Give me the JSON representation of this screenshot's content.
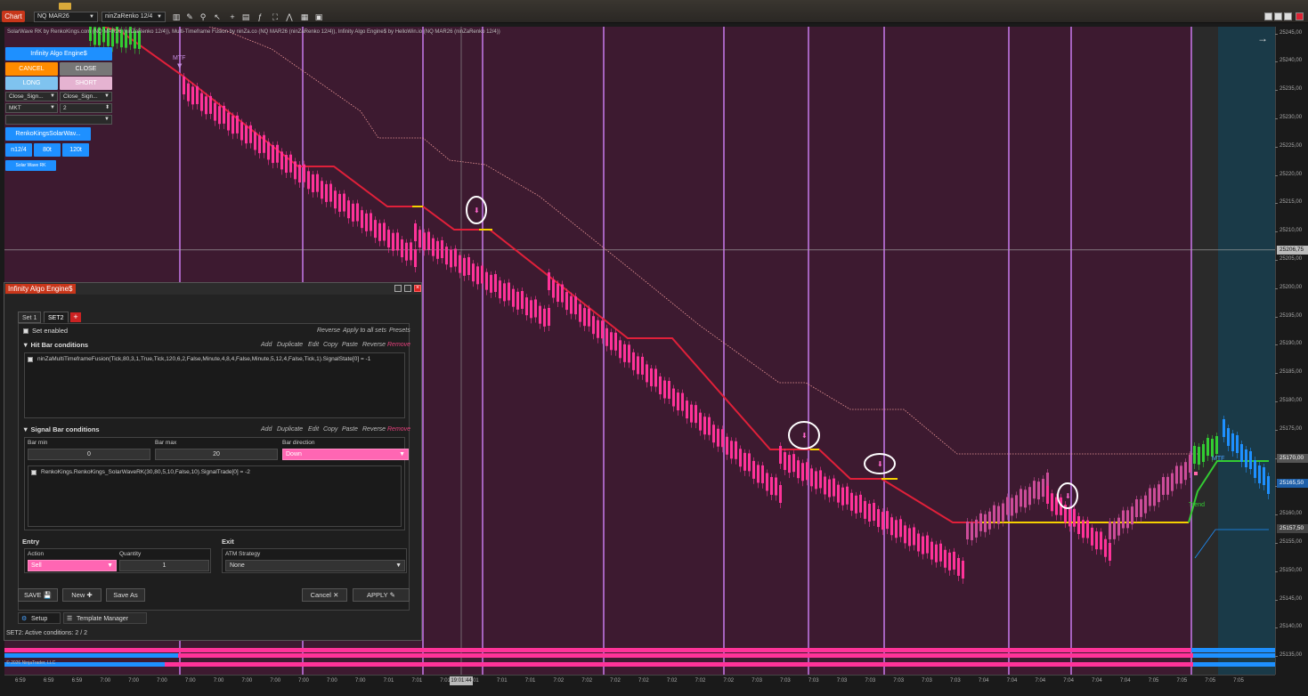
{
  "window": {
    "chart_tab": "Chart"
  },
  "toolbar": {
    "instrument": "NQ MAR26",
    "bar_type": "ninZaRenko 12/4"
  },
  "chart": {
    "legend": "SolarWave RK by RenkoKings.com (NQ MAR26 (ninZaRenko 12/4)), Multi-Timeframe Fusion by ninZa.co (NQ MAR26 (ninZaRenko 12/4)), Infinity Algo Engine$ by HelloWin.io (NQ MAR26 (ninZaRenko 12/4))",
    "mtf_label": "MTF",
    "trend_label": "Trend",
    "mtf_label_2": "MTF",
    "price_labels": [
      "25245,00",
      "25240,00",
      "25235,00",
      "25230,00",
      "25225,00",
      "25220,00",
      "25215,00",
      "25210,00",
      "25205,00",
      "25200,00",
      "25195,00",
      "25190,00",
      "25185,00",
      "25180,00",
      "25175,00",
      "25170,00",
      "25165,00",
      "25160,00",
      "25155,00",
      "25150,00",
      "25145,00",
      "25140,00",
      "25135,00"
    ],
    "price_badges": {
      "crosshair": "25206,75",
      "current": "25170,00",
      "blue": "25165,50",
      "low": "25157,50"
    },
    "time_labels": [
      "6:59",
      "6:59",
      "6:59",
      "7:00",
      "7:00",
      "7:00",
      "7:00",
      "7:00",
      "7:00",
      "7:00",
      "7:00",
      "7:00",
      "7:00",
      "7:01",
      "7:01",
      "7:01",
      "7:01",
      "7:01",
      "7:01",
      "7:02",
      "7:02",
      "7:02",
      "7:02",
      "7:02",
      "7:02",
      "7:02",
      "7:03",
      "7:03",
      "7:03",
      "7:03",
      "7:03",
      "7:03",
      "7:03",
      "7:03",
      "7:04",
      "7:04",
      "7:04",
      "7:04",
      "7:04",
      "7:04",
      "7:05",
      "7:05",
      "7:05",
      "7:05"
    ],
    "time_cursor": "19:01:44",
    "copyright": "© 2026 NinjaTrader, LLC"
  },
  "trade_panel": {
    "title": "Infinity Algo Engine$",
    "cancel": "CANCEL",
    "close": "CLOSE",
    "long": "LONG",
    "short": "SHORT",
    "select1": "Close_Sign...",
    "select2": "Close_Sign...",
    "order_type": "MKT",
    "qty": "2",
    "template": "RenkoKingsSolarWav...",
    "btn_a": "n12/4",
    "btn_b": "80t",
    "btn_c": "120t",
    "tag": "Solar Wave RK"
  },
  "algo": {
    "title": "Infinity Algo Engine$",
    "tabs": [
      "Set 1",
      "SET2"
    ],
    "tab_add": "+",
    "set_enabled": "Set enabled",
    "reverse": "Reverse",
    "apply_all": "Apply to all sets",
    "presets": "Presets",
    "hit_bar": "Hit Bar conditions",
    "signal_bar": "Signal Bar conditions",
    "actions": {
      "add": "Add",
      "duplicate": "Duplicate",
      "edit": "Edit",
      "copy": "Copy",
      "paste": "Paste",
      "reverse": "Reverse",
      "remove": "Remove"
    },
    "hit_condition": "ninZaMultiTimeframeFusion(Tick,80,3,1,True,Tick,120,6,2,False,Minute,4,8,4,False,Minute,5,12,4,False,Tick,1).SignalState[0] = -1",
    "bar_min_label": "Bar min",
    "bar_min": "0",
    "bar_max_label": "Bar max",
    "bar_max": "20",
    "bar_dir_label": "Bar direction",
    "bar_dir": "Down",
    "signal_condition": "RenkoKings.RenkoKings_SolarWaveRK(30,80,5,10,False,10).SignalTrade[0] = -2",
    "entry": "Entry",
    "action_label": "Action",
    "action": "Sell",
    "quantity_label": "Quantity",
    "quantity": "1",
    "exit": "Exit",
    "atm_label": "ATM Strategy",
    "atm": "None",
    "save": "SAVE",
    "new": "New",
    "save_as": "Save As",
    "cancel": "Cancel",
    "apply": "APPLY",
    "setup_tab": "Setup",
    "template_tab": "Template Manager",
    "status": "SET2: Active conditions: 2 / 2"
  },
  "colors": {
    "chart_bg": "#161616",
    "zone_magenta": "#3d1a30",
    "zone_teal": "#1a3a48",
    "bar_pink": "#ff3399",
    "red_line": "#e0203a",
    "yellow_line": "#f5d000",
    "green_line": "#33cc33",
    "violet_line": "#b86fd6",
    "accent_blue": "#1e90ff",
    "orange": "#ff8c00"
  }
}
